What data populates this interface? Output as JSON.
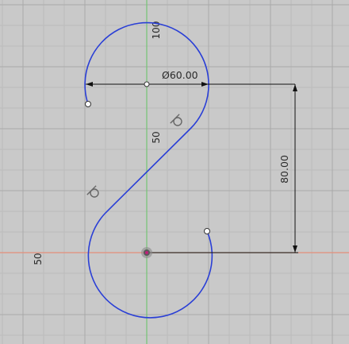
{
  "viewport": {
    "background": "#c9c9c9",
    "grid_minor_color": "#bcbcbc",
    "grid_major_color": "#a9a9a9",
    "x_axis_color": "#e58f7a",
    "y_axis_color": "#74c474"
  },
  "sketch": {
    "curve_color": "#2a3fd6",
    "point_color": "#ffffff"
  },
  "grid_labels": {
    "y_100": "100",
    "y_50": "50",
    "x_50": "50"
  },
  "dimensions": {
    "diameter": "Ø60.00",
    "vertical": "80.00"
  },
  "constraint_icons": [
    "tangent-constraint-icon",
    "tangent-constraint-icon"
  ],
  "origin_icon": "origin-point-icon"
}
